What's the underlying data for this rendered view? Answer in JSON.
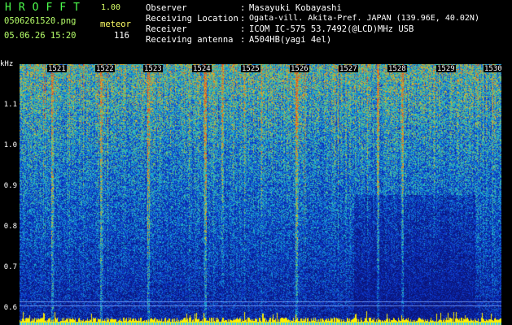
{
  "header": {
    "title": "HROFFT",
    "version": "1.00",
    "filename": "0506261520.png",
    "datetime": "05.06.26 15:20",
    "type_label": "meteor",
    "count": "116"
  },
  "info": {
    "labels": [
      "Observer",
      "Receiving Location",
      "Receiver",
      "Receiving antenna"
    ],
    "separator": ":",
    "values": [
      "Masayuki Kobayashi",
      "Ogata-vill. Akita-Pref. JAPAN (139.96E, 40.02N)",
      "ICOM IC-575 53.7492(@LCD)MHz USB",
      "A504HB(yagi 4el)"
    ]
  },
  "spectrogram": {
    "yunit": "kHz",
    "yticks": [
      "1.1",
      "1.0",
      "0.9",
      "0.8",
      "0.7",
      "0.6"
    ],
    "xticks": [
      "1521",
      "1522",
      "1523",
      "1524",
      "1525",
      "1526",
      "1527",
      "1528",
      "1529",
      "1530"
    ],
    "colors": {
      "low": "#0a1a8c",
      "mid": "#1aa0c8",
      "high": "#30d070",
      "peak": "#ff3030",
      "baseline": "#ffee00"
    }
  }
}
